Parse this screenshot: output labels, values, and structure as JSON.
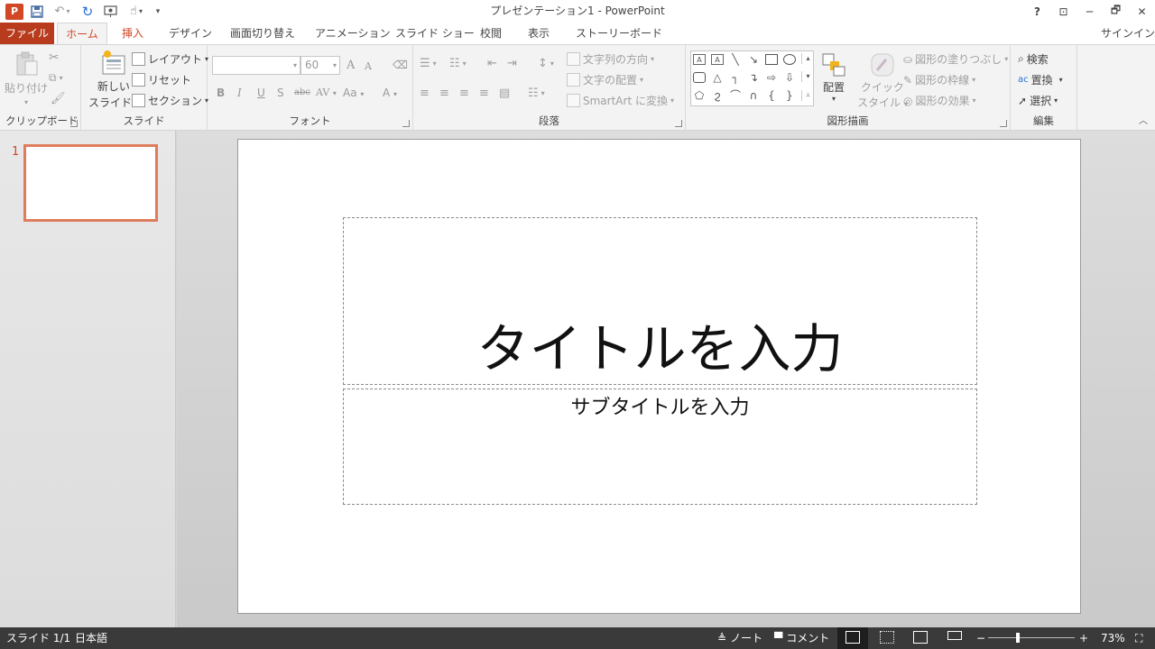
{
  "titlebar": {
    "title": "プレゼンテーション1 - PowerPoint",
    "logo_text": "P",
    "help": "?",
    "ribbon_display": "⊡",
    "minimize": "─",
    "restore": "🗗",
    "close": "✕"
  },
  "tabs": {
    "file": "ファイル",
    "home": "ホーム",
    "insert": "挿入",
    "design": "デザイン",
    "transitions": "画面切り替え",
    "animations": "アニメーション",
    "slideshow": "スライド ショー",
    "review": "校閲",
    "view": "表示",
    "storyboard": "ストーリーボード",
    "signin": "サインイン"
  },
  "ribbon": {
    "clipboard": {
      "paste": "貼り付け",
      "label": "クリップボード"
    },
    "slides": {
      "new_slide_line1": "新しい",
      "new_slide_line2": "スライド",
      "layout": "レイアウト",
      "reset": "リセット",
      "section": "セクション",
      "label": "スライド"
    },
    "font": {
      "font_name": "",
      "font_size": "60",
      "bold": "B",
      "italic": "I",
      "underline": "U",
      "shadow": "S",
      "strike": "abc",
      "spacing": "AV",
      "case": "Aa",
      "color": "A",
      "grow": "A",
      "shrink": "A",
      "label": "フォント"
    },
    "paragraph": {
      "text_direction": "文字列の方向",
      "align_text": "文字の配置",
      "smartart": "SmartArt に変換",
      "label": "段落"
    },
    "drawing": {
      "arrange": "配置",
      "quick_styles_line1": "クイック",
      "quick_styles_line2": "スタイル",
      "shape_fill": "図形の塗りつぶし",
      "shape_outline": "図形の枠線",
      "shape_effects": "図形の効果",
      "label": "図形描画"
    },
    "editing": {
      "find": "検索",
      "replace": "置換",
      "select": "選択",
      "label": "編集"
    }
  },
  "thumbnails": {
    "slide_number": "1"
  },
  "slide": {
    "title_placeholder": "タイトルを入力",
    "subtitle_placeholder": "サブタイトルを入力"
  },
  "statusbar": {
    "slide_info": "スライド 1/1",
    "language": "日本語",
    "notes": "ノート",
    "comments": "コメント",
    "zoom_minus": "−",
    "zoom_plus": "+",
    "zoom_level": "73%"
  }
}
